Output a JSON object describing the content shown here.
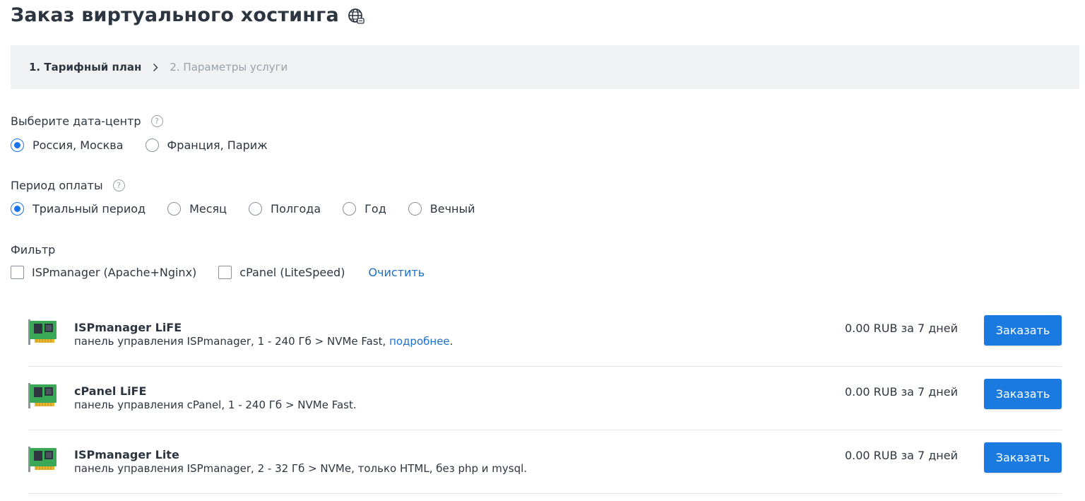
{
  "header": {
    "title": "Заказ виртуального хостинга",
    "icon": "globe-icon"
  },
  "stepper": {
    "steps": [
      {
        "label": "1. Тарифный план",
        "active": true
      },
      {
        "label": "2. Параметры услуги",
        "active": false
      }
    ]
  },
  "datacenter": {
    "label": "Выберите дата-центр",
    "help": "?",
    "options": [
      {
        "label": "Россия, Москва",
        "checked": true
      },
      {
        "label": "Франция, Париж",
        "checked": false
      }
    ]
  },
  "period": {
    "label": "Период оплаты",
    "help": "?",
    "options": [
      {
        "label": "Триальный период",
        "checked": true
      },
      {
        "label": "Месяц",
        "checked": false
      },
      {
        "label": "Полгода",
        "checked": false
      },
      {
        "label": "Год",
        "checked": false
      },
      {
        "label": "Вечный",
        "checked": false
      }
    ]
  },
  "filter": {
    "label": "Фильтр",
    "options": [
      {
        "label": "ISPmanager (Apache+Nginx)",
        "checked": false
      },
      {
        "label": "cPanel (LiteSpeed)",
        "checked": false
      }
    ],
    "clear_label": "Очистить"
  },
  "plans": [
    {
      "name": "ISPmanager LiFE",
      "desc": "панель управления ISPmanager, 1 - 240 Гб > NVMe Fast, ",
      "link": "подробнее",
      "desc_end": ".",
      "price": "0.00 RUB за 7 дней",
      "button": "Заказать"
    },
    {
      "name": "cPanel LiFE",
      "desc": "панель управления cPanel, 1 - 240 Гб > NVMe Fast.",
      "price": "0.00 RUB за 7 дней",
      "button": "Заказать"
    },
    {
      "name": "ISPmanager Lite",
      "desc": "панель управления ISPmanager, 2 - 32 Гб > NVMe, только HTML, без php и mysql.",
      "price": "0.00 RUB за 7 дней",
      "button": "Заказать"
    }
  ],
  "colors": {
    "accent": "#1a7ae0",
    "link": "#1a6fd1",
    "text": "#2d3640",
    "muted": "#9aa1a8",
    "stepper_bg": "#eff1f3",
    "card_green": "#3aa856"
  }
}
